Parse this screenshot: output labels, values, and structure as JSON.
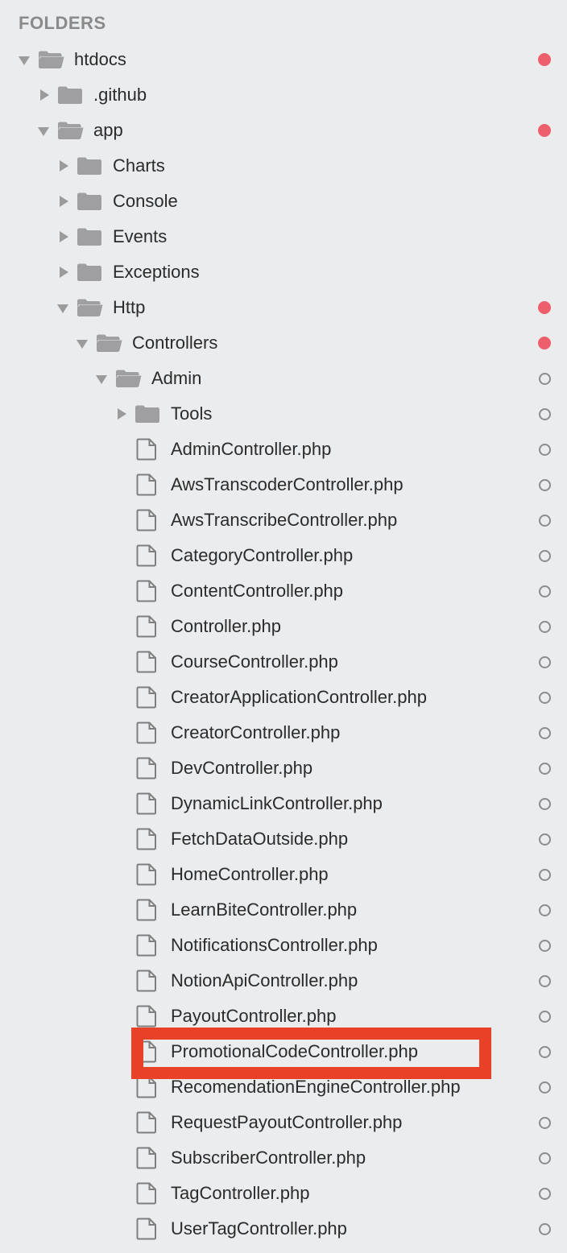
{
  "sidebar": {
    "header": "FOLDERS",
    "status_colors": {
      "modified": "#ed5f6b",
      "clean": "#8c8c8c"
    },
    "highlight_color": "#e84128",
    "items": [
      {
        "label": "htdocs",
        "type": "folder",
        "expanded": true,
        "depth": 0,
        "status": "modified"
      },
      {
        "label": ".github",
        "type": "folder",
        "expanded": false,
        "depth": 1,
        "status": "none"
      },
      {
        "label": "app",
        "type": "folder",
        "expanded": true,
        "depth": 1,
        "status": "modified"
      },
      {
        "label": "Charts",
        "type": "folder",
        "expanded": false,
        "depth": 2,
        "status": "none"
      },
      {
        "label": "Console",
        "type": "folder",
        "expanded": false,
        "depth": 2,
        "status": "none"
      },
      {
        "label": "Events",
        "type": "folder",
        "expanded": false,
        "depth": 2,
        "status": "none"
      },
      {
        "label": "Exceptions",
        "type": "folder",
        "expanded": false,
        "depth": 2,
        "status": "none"
      },
      {
        "label": "Http",
        "type": "folder",
        "expanded": true,
        "depth": 2,
        "status": "modified"
      },
      {
        "label": "Controllers",
        "type": "folder",
        "expanded": true,
        "depth": 3,
        "status": "modified"
      },
      {
        "label": "Admin",
        "type": "folder",
        "expanded": true,
        "depth": 4,
        "status": "clean"
      },
      {
        "label": "Tools",
        "type": "folder",
        "expanded": false,
        "depth": 5,
        "status": "clean"
      },
      {
        "label": "AdminController.php",
        "type": "file",
        "depth": 5,
        "status": "clean"
      },
      {
        "label": "AwsTranscoderController.php",
        "type": "file",
        "depth": 5,
        "status": "clean"
      },
      {
        "label": "AwsTranscribeController.php",
        "type": "file",
        "depth": 5,
        "status": "clean"
      },
      {
        "label": "CategoryController.php",
        "type": "file",
        "depth": 5,
        "status": "clean"
      },
      {
        "label": "ContentController.php",
        "type": "file",
        "depth": 5,
        "status": "clean"
      },
      {
        "label": "Controller.php",
        "type": "file",
        "depth": 5,
        "status": "clean"
      },
      {
        "label": "CourseController.php",
        "type": "file",
        "depth": 5,
        "status": "clean"
      },
      {
        "label": "CreatorApplicationController.php",
        "type": "file",
        "depth": 5,
        "status": "clean"
      },
      {
        "label": "CreatorController.php",
        "type": "file",
        "depth": 5,
        "status": "clean"
      },
      {
        "label": "DevController.php",
        "type": "file",
        "depth": 5,
        "status": "clean"
      },
      {
        "label": "DynamicLinkController.php",
        "type": "file",
        "depth": 5,
        "status": "clean"
      },
      {
        "label": "FetchDataOutside.php",
        "type": "file",
        "depth": 5,
        "status": "clean"
      },
      {
        "label": "HomeController.php",
        "type": "file",
        "depth": 5,
        "status": "clean"
      },
      {
        "label": "LearnBiteController.php",
        "type": "file",
        "depth": 5,
        "status": "clean"
      },
      {
        "label": "NotificationsController.php",
        "type": "file",
        "depth": 5,
        "status": "clean"
      },
      {
        "label": "NotionApiController.php",
        "type": "file",
        "depth": 5,
        "status": "clean"
      },
      {
        "label": "PayoutController.php",
        "type": "file",
        "depth": 5,
        "status": "clean"
      },
      {
        "label": "PromotionalCodeController.php",
        "type": "file",
        "depth": 5,
        "status": "clean",
        "highlighted": true
      },
      {
        "label": "RecomendationEngineController.php",
        "type": "file",
        "depth": 5,
        "status": "clean"
      },
      {
        "label": "RequestPayoutController.php",
        "type": "file",
        "depth": 5,
        "status": "clean"
      },
      {
        "label": "SubscriberController.php",
        "type": "file",
        "depth": 5,
        "status": "clean"
      },
      {
        "label": "TagController.php",
        "type": "file",
        "depth": 5,
        "status": "clean"
      },
      {
        "label": "UserTagController.php",
        "type": "file",
        "depth": 5,
        "status": "clean"
      }
    ]
  }
}
